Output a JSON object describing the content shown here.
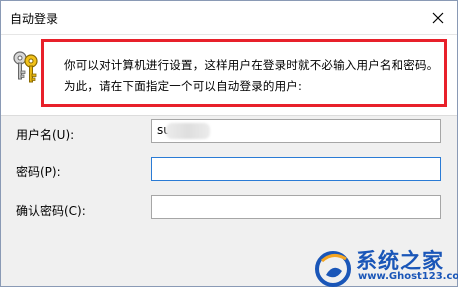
{
  "window": {
    "title": "自动登录",
    "close_icon": "close-icon"
  },
  "info": {
    "icon": "keys-icon",
    "description": "你可以对计算机进行设置，这样用户在登录时就不必输入用户名和密码。为此，请在下面指定一个可以自动登录的用户:",
    "highlight_color": "#e8202a"
  },
  "form": {
    "username_label": "用户名(U):",
    "username_value": "su",
    "password_label": "密码(P):",
    "password_value": "",
    "confirm_label": "确认密码(C):",
    "confirm_value": ""
  },
  "watermark": {
    "title": "系统之家",
    "url": "www.Ghost123.com"
  }
}
